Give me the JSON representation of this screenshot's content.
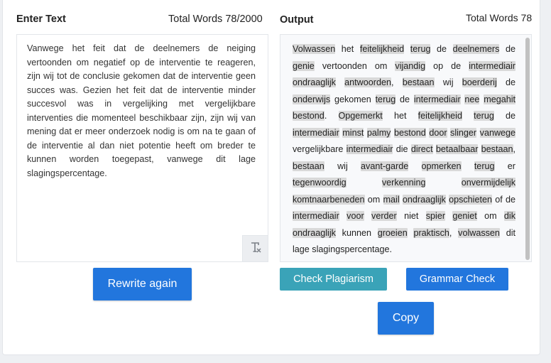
{
  "input": {
    "title": "Enter Text",
    "word_count": "Total Words 78/2000",
    "text": "Vanwege het feit dat de deelnemers de neiging vertoonden om negatief op de interventie te reageren, zijn wij tot de conclusie gekomen dat de interventie geen succes was. Gezien het feit dat de interventie minder succesvol was in vergelijking met vergelijkbare interventies die momenteel beschikbaar zijn, zijn wij van mening dat er meer onderzoek nodig is om na te gaan of de interventie al dan niet potentie heeft om breder te kunnen worden toegepast, vanwege dit lage slagingspercentage.",
    "clear_icon": "clear-format-icon"
  },
  "output": {
    "title": "Output",
    "word_count": "Total Words 78",
    "tokens": [
      {
        "t": "Volwassen",
        "h": true
      },
      {
        "t": " het "
      },
      {
        "t": "feitelijkheid",
        "h": true
      },
      {
        "t": " "
      },
      {
        "t": "terug",
        "h": true
      },
      {
        "t": " de "
      },
      {
        "t": "deelnemers",
        "h": true
      },
      {
        "t": " de "
      },
      {
        "t": "genie",
        "h": true
      },
      {
        "t": " vertoonden om "
      },
      {
        "t": "vijandig",
        "h": true
      },
      {
        "t": " op de "
      },
      {
        "t": "intermediair",
        "h": true
      },
      {
        "t": " "
      },
      {
        "t": "ondraaglijk",
        "h": true
      },
      {
        "t": " "
      },
      {
        "t": "antwoorden",
        "h": true
      },
      {
        "t": ", "
      },
      {
        "t": "bestaan",
        "h": true
      },
      {
        "t": " wij "
      },
      {
        "t": "boerderij",
        "h": true
      },
      {
        "t": " de "
      },
      {
        "t": "onderwijs",
        "h": true
      },
      {
        "t": " gekomen "
      },
      {
        "t": "terug",
        "h": true
      },
      {
        "t": " de "
      },
      {
        "t": "intermediair",
        "h": true
      },
      {
        "t": " "
      },
      {
        "t": "nee",
        "h": true
      },
      {
        "t": " "
      },
      {
        "t": "megahit",
        "h": true
      },
      {
        "t": " "
      },
      {
        "t": "bestond",
        "h": true
      },
      {
        "t": ". "
      },
      {
        "t": "Opgemerkt",
        "h": true
      },
      {
        "t": " het "
      },
      {
        "t": "feitelijkheid",
        "h": true
      },
      {
        "t": " "
      },
      {
        "t": "terug",
        "h": true
      },
      {
        "t": " de "
      },
      {
        "t": "intermediair",
        "h": true
      },
      {
        "t": " "
      },
      {
        "t": "minst",
        "h": true
      },
      {
        "t": " "
      },
      {
        "t": "palmy",
        "h": true
      },
      {
        "t": " "
      },
      {
        "t": "bestond",
        "h": true
      },
      {
        "t": " "
      },
      {
        "t": "door",
        "h": true
      },
      {
        "t": " "
      },
      {
        "t": "slinger",
        "h": true
      },
      {
        "t": " "
      },
      {
        "t": "vanwege",
        "h": true
      },
      {
        "t": " vergelijkbare "
      },
      {
        "t": "intermediair",
        "h": true
      },
      {
        "t": " die "
      },
      {
        "t": "direct",
        "h": true
      },
      {
        "t": " "
      },
      {
        "t": "betaalbaar",
        "h": true
      },
      {
        "t": " "
      },
      {
        "t": "bestaan",
        "h": true
      },
      {
        "t": ", "
      },
      {
        "t": "bestaan",
        "h": true
      },
      {
        "t": " wij "
      },
      {
        "t": "avant-garde",
        "h": true
      },
      {
        "t": " "
      },
      {
        "t": "opmerken",
        "h": true
      },
      {
        "t": " "
      },
      {
        "t": "terug",
        "h": true
      },
      {
        "t": " er "
      },
      {
        "t": "tegenwoordig",
        "h": true
      },
      {
        "t": " "
      },
      {
        "t": "verkenning",
        "h": true
      },
      {
        "t": " "
      },
      {
        "t": "onvermijdelijk",
        "h": true
      },
      {
        "t": " "
      },
      {
        "t": "komtnaarbeneden",
        "h": true
      },
      {
        "t": " om "
      },
      {
        "t": "mail",
        "h": true
      },
      {
        "t": " "
      },
      {
        "t": "ondraaglijk",
        "h": true
      },
      {
        "t": " "
      },
      {
        "t": "opschieten",
        "h": true
      },
      {
        "t": " of de "
      },
      {
        "t": "intermediair",
        "h": true
      },
      {
        "t": " "
      },
      {
        "t": "voor",
        "h": true
      },
      {
        "t": " "
      },
      {
        "t": "verder",
        "h": true
      },
      {
        "t": " niet "
      },
      {
        "t": "spier",
        "h": true
      },
      {
        "t": " "
      },
      {
        "t": "geniet",
        "h": true
      },
      {
        "t": " om "
      },
      {
        "t": "dik",
        "h": true
      },
      {
        "t": " "
      },
      {
        "t": "ondraaglijk",
        "h": true
      },
      {
        "t": " kunnen "
      },
      {
        "t": "groeien",
        "h": true
      },
      {
        "t": " "
      },
      {
        "t": "praktisch",
        "h": true
      },
      {
        "t": ", "
      },
      {
        "t": "volwassen",
        "h": true
      },
      {
        "t": " dit lage slagingspercentage."
      }
    ]
  },
  "buttons": {
    "rewrite": "Rewrite again",
    "plagiarism": "Check Plagiarism",
    "grammar": "Grammar Check",
    "copy": "Copy"
  }
}
